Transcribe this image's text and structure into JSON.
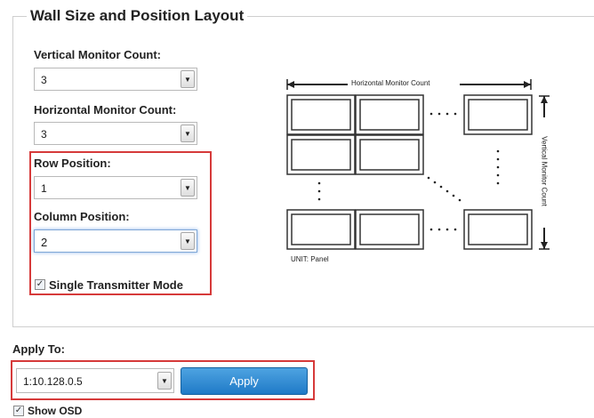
{
  "section": {
    "title": "Wall Size and Position Layout"
  },
  "vertical_count": {
    "label": "Vertical Monitor Count:",
    "value": "3"
  },
  "horizontal_count": {
    "label": "Horizontal Monitor Count:",
    "value": "3"
  },
  "row_position": {
    "label": "Row Position:",
    "value": "1"
  },
  "column_position": {
    "label": "Column Position:",
    "value": "2"
  },
  "single_transmitter": {
    "label": "Single Transmitter Mode",
    "checked": true
  },
  "diagram": {
    "horizontal_label": "Horizontal Monitor Count",
    "vertical_label": "Vertical Monitor Count",
    "unit_label": "UNIT: Panel"
  },
  "apply_to": {
    "label": "Apply To:",
    "value": "1:10.128.0.5",
    "button_label": "Apply"
  },
  "show_osd": {
    "label": "Show OSD",
    "checked": true
  },
  "colors": {
    "highlight": "#d63a3a",
    "button": "#2a86d0"
  }
}
